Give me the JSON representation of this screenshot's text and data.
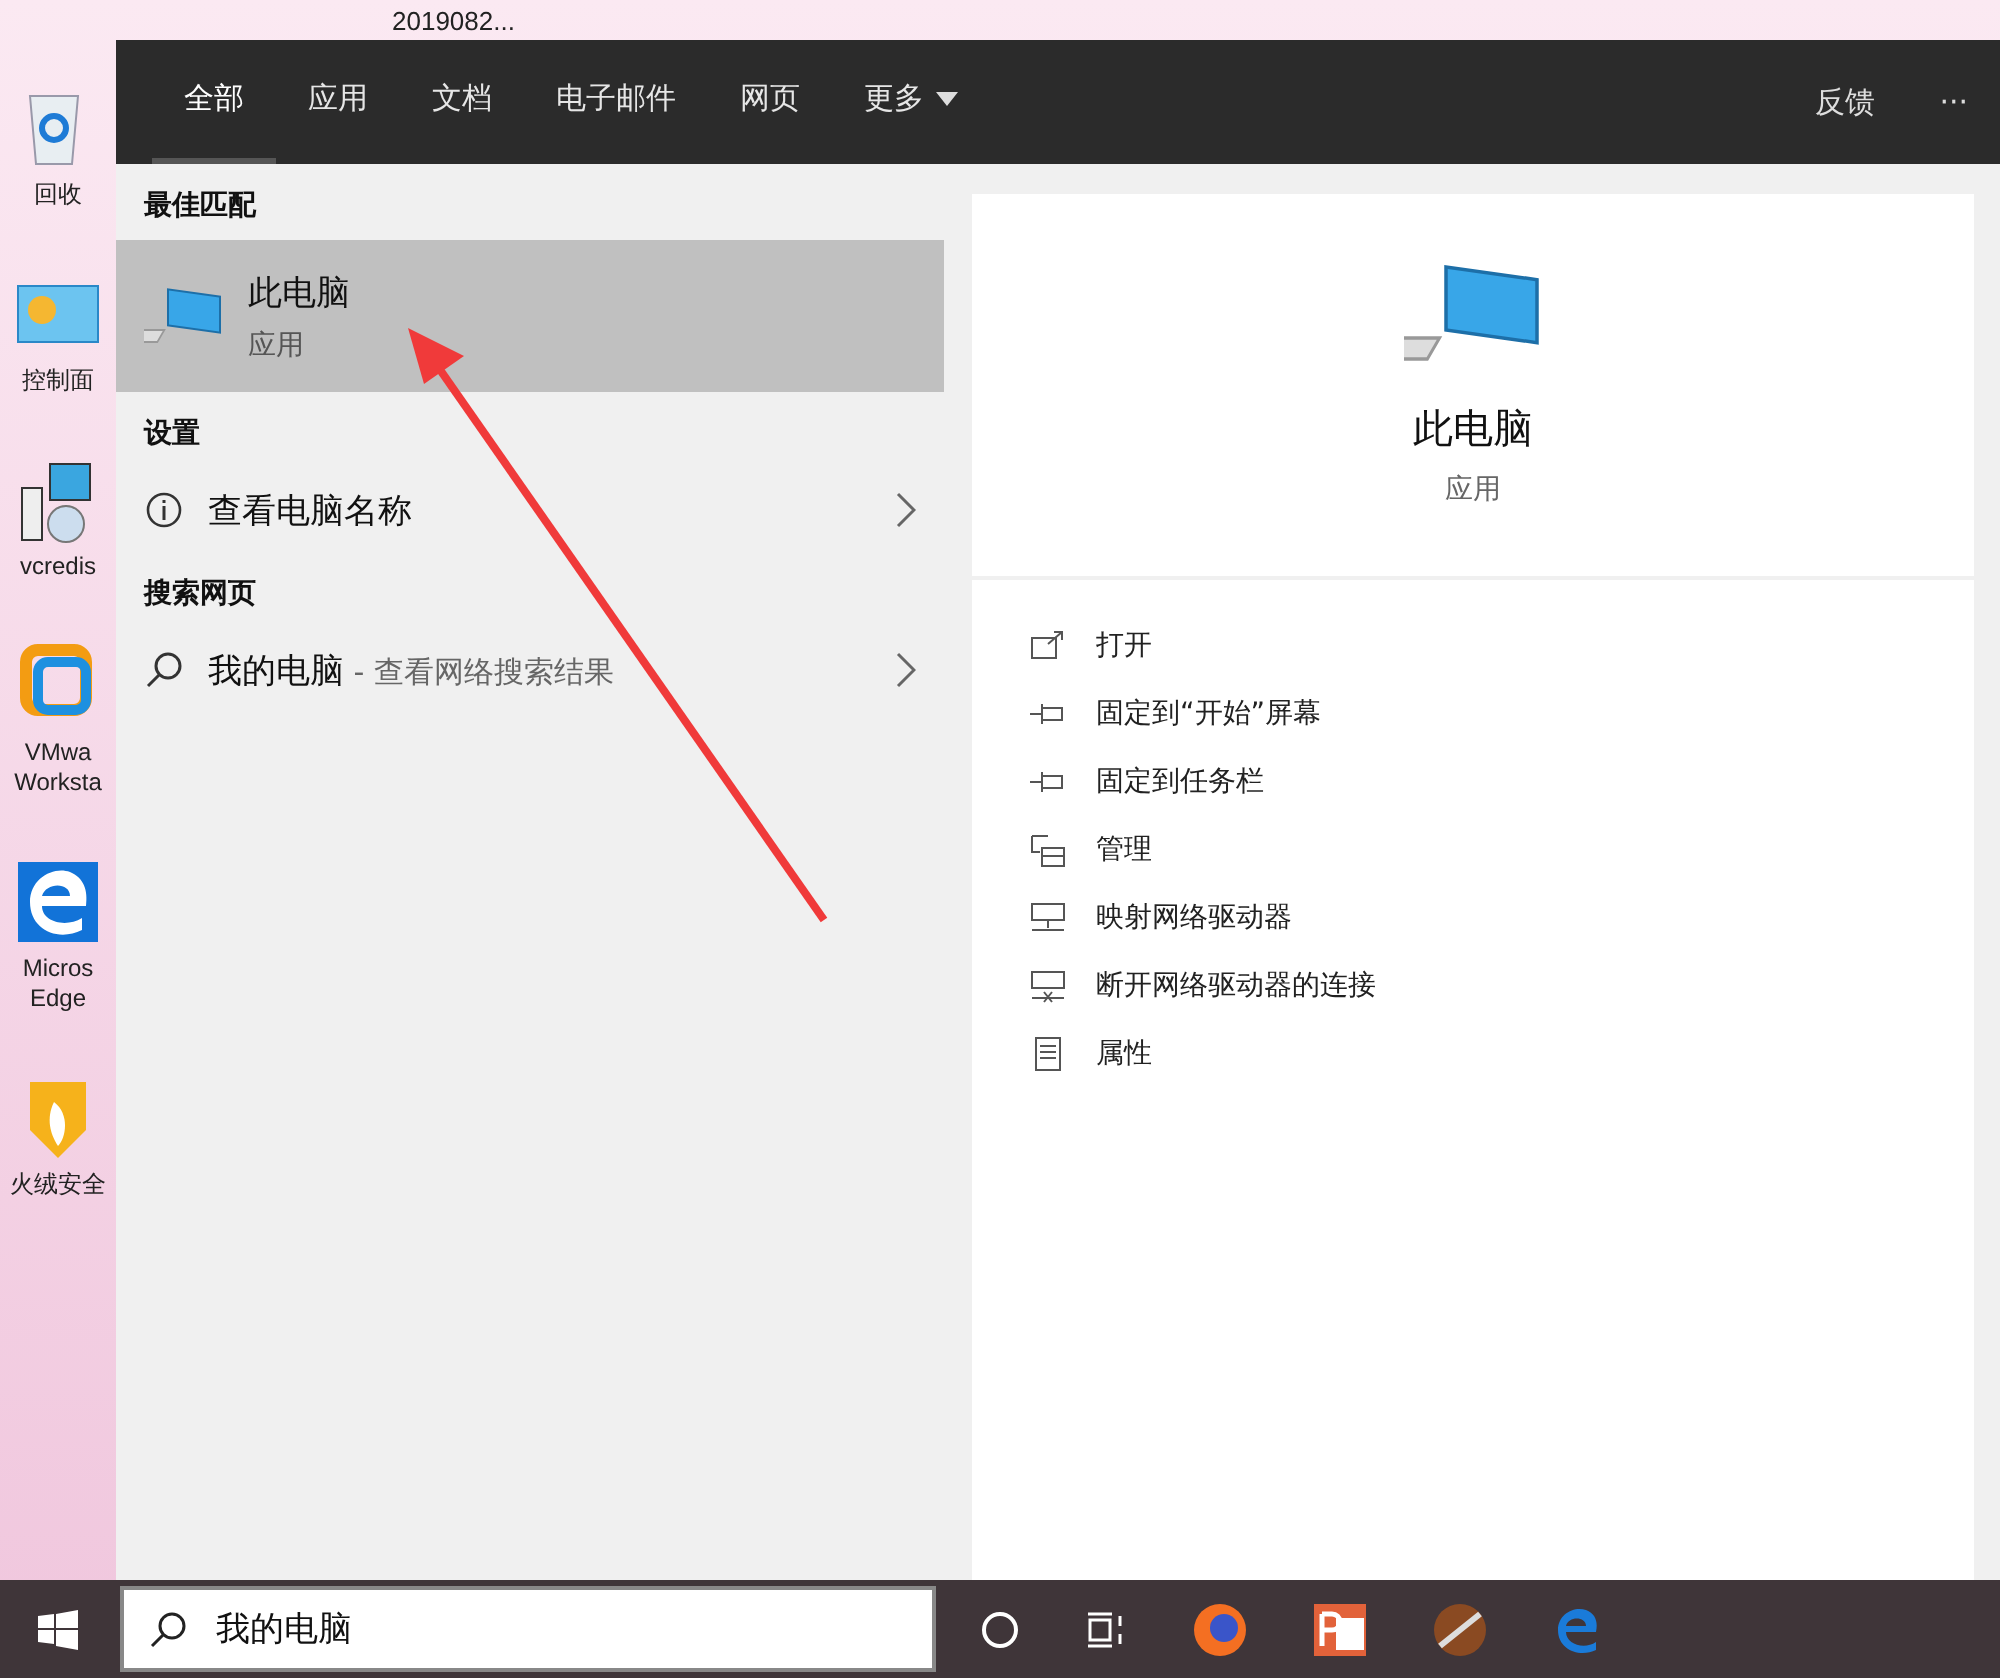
{
  "desktop": {
    "top_label": "2019082...",
    "icons": [
      {
        "kind": "recycle",
        "label": "回收"
      },
      {
        "kind": "control",
        "label": "控制面"
      },
      {
        "kind": "installer",
        "label": "vcredis"
      },
      {
        "kind": "vmware",
        "label": "VMwa Worksta"
      },
      {
        "kind": "edge",
        "label": "Micros Edge"
      },
      {
        "kind": "shield",
        "label": "火绒安全"
      }
    ]
  },
  "search_panel": {
    "tabs": [
      {
        "label": "全部",
        "selected": true
      },
      {
        "label": "应用",
        "selected": false
      },
      {
        "label": "文档",
        "selected": false
      },
      {
        "label": "电子邮件",
        "selected": false
      },
      {
        "label": "网页",
        "selected": false
      },
      {
        "label": "更多",
        "selected": false,
        "dropdown": true
      }
    ],
    "feedback": "反馈",
    "more_menu": "···",
    "sections": [
      {
        "title": "最佳匹配",
        "items": [
          {
            "kind": "app",
            "title": "此电脑",
            "subtitle": "应用",
            "selected": true
          }
        ]
      },
      {
        "title": "设置",
        "items": [
          {
            "kind": "info",
            "title": "查看电脑名称",
            "selected": false
          }
        ]
      },
      {
        "title": "搜索网页",
        "items": [
          {
            "kind": "web",
            "title": "我的电脑",
            "subtitle": " - 查看网络搜索结果",
            "selected": false
          }
        ]
      }
    ],
    "preview": {
      "title": "此电脑",
      "subtitle": "应用",
      "actions": [
        {
          "kind": "open",
          "label": "打开"
        },
        {
          "kind": "pin",
          "label": "固定到“开始”屏幕"
        },
        {
          "kind": "pin",
          "label": "固定到任务栏"
        },
        {
          "kind": "manage",
          "label": "管理"
        },
        {
          "kind": "map",
          "label": "映射网络驱动器"
        },
        {
          "kind": "disconnect",
          "label": "断开网络驱动器的连接"
        },
        {
          "kind": "properties",
          "label": "属性"
        }
      ]
    }
  },
  "taskbar": {
    "search_value": "我的电脑",
    "apps": [
      {
        "kind": "cortana"
      },
      {
        "kind": "taskview"
      },
      {
        "kind": "firefox"
      },
      {
        "kind": "powerpoint"
      },
      {
        "kind": "music"
      },
      {
        "kind": "edge"
      }
    ]
  }
}
